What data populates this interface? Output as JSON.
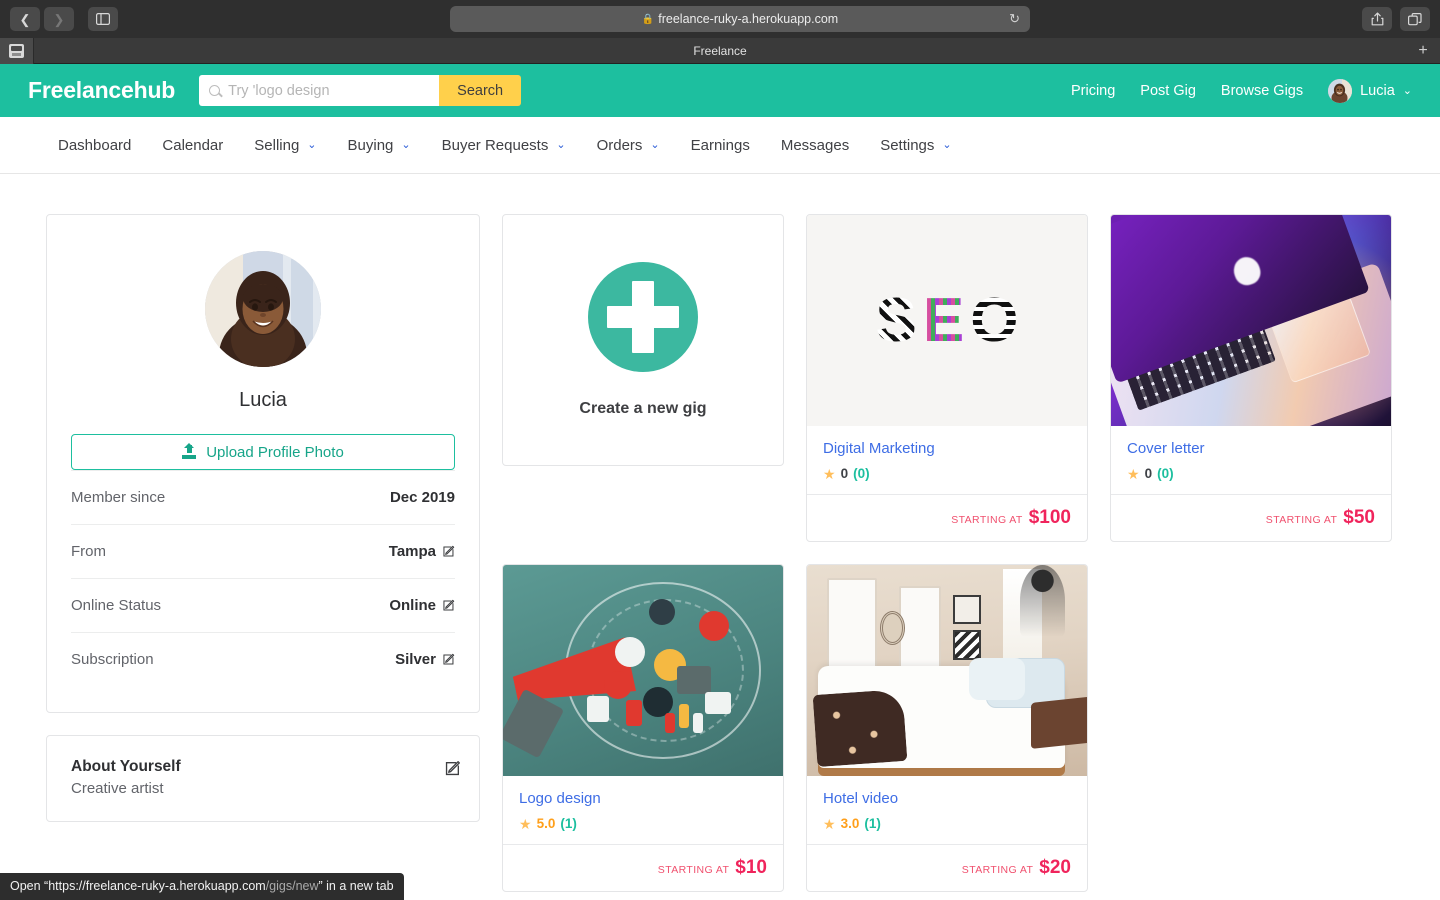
{
  "browser": {
    "back_icon": "back-arrow-icon",
    "forward_icon": "forward-arrow-icon",
    "sidebar_icon": "sidebar-toggle-icon",
    "url": "freelance-ruky-a.herokuapp.com",
    "lock_glyph": "🔒",
    "reload_glyph": "↻",
    "share_icon": "share-icon",
    "tabs_icon": "new-tab-overview-icon",
    "tab_title": "Freelance",
    "new_tab_glyph": "+"
  },
  "header": {
    "brand": "Freelancehub",
    "search": {
      "placeholder": "Try 'logo design",
      "value": "",
      "button_label": "Search"
    },
    "links": [
      {
        "label": "Pricing"
      },
      {
        "label": "Post Gig"
      },
      {
        "label": "Browse Gigs"
      }
    ],
    "user": {
      "name": "Lucia",
      "caret": "⌄"
    }
  },
  "nav": {
    "items": [
      {
        "label": "Dashboard",
        "has_caret": false
      },
      {
        "label": "Calendar",
        "has_caret": false
      },
      {
        "label": "Selling",
        "has_caret": true
      },
      {
        "label": "Buying",
        "has_caret": true
      },
      {
        "label": "Buyer Requests",
        "has_caret": true
      },
      {
        "label": "Orders",
        "has_caret": true
      },
      {
        "label": "Earnings",
        "has_caret": false
      },
      {
        "label": "Messages",
        "has_caret": false
      },
      {
        "label": "Settings",
        "has_caret": true
      }
    ],
    "caret_glyph": "⌄"
  },
  "profile": {
    "name": "Lucia",
    "avatar_name": "user-avatar-photo",
    "upload_label": "Upload Profile Photo",
    "rows": [
      {
        "label": "Member since",
        "value": "Dec 2019",
        "editable": false
      },
      {
        "label": "From",
        "value": "Tampa",
        "editable": true
      },
      {
        "label": "Online Status",
        "value": "Online",
        "editable": true
      },
      {
        "label": "Subscription",
        "value": "Silver",
        "editable": true
      }
    ]
  },
  "about": {
    "title": "About Yourself",
    "text": "Creative artist"
  },
  "create_gig": {
    "label": "Create a new gig",
    "icon": "plus-icon"
  },
  "gigs": [
    {
      "title": "Digital Marketing",
      "rating": "0",
      "rating_is_zero": true,
      "reviews": "(0)",
      "starting_label": "STARTING AT",
      "price": "$100",
      "thumb": "seo-letters-photo"
    },
    {
      "title": "Cover letter",
      "rating": "0",
      "rating_is_zero": true,
      "reviews": "(0)",
      "starting_label": "STARTING AT",
      "price": "$50",
      "thumb": "purple-laptop-photo"
    },
    {
      "title": "Logo design",
      "rating": "5.0",
      "rating_is_zero": false,
      "reviews": "(1)",
      "starting_label": "STARTING AT",
      "price": "$10",
      "thumb": "marketing-megaphone-illustration"
    },
    {
      "title": "Hotel video",
      "rating": "3.0",
      "rating_is_zero": false,
      "reviews": "(1)",
      "starting_label": "STARTING AT",
      "price": "$20",
      "thumb": "hotel-bedroom-photo"
    }
  ],
  "status_bar": {
    "prefix": "Open “https://freelance-ruky-a.herokuapp.com",
    "path": "/gigs/new",
    "suffix": "” in a new tab"
  },
  "colors": {
    "brand_teal": "#1dbf9f",
    "search_yellow": "#ffd04b",
    "link_blue": "#3e6de5",
    "price_red": "#f0245c",
    "star_amber": "#ffbe5b"
  }
}
